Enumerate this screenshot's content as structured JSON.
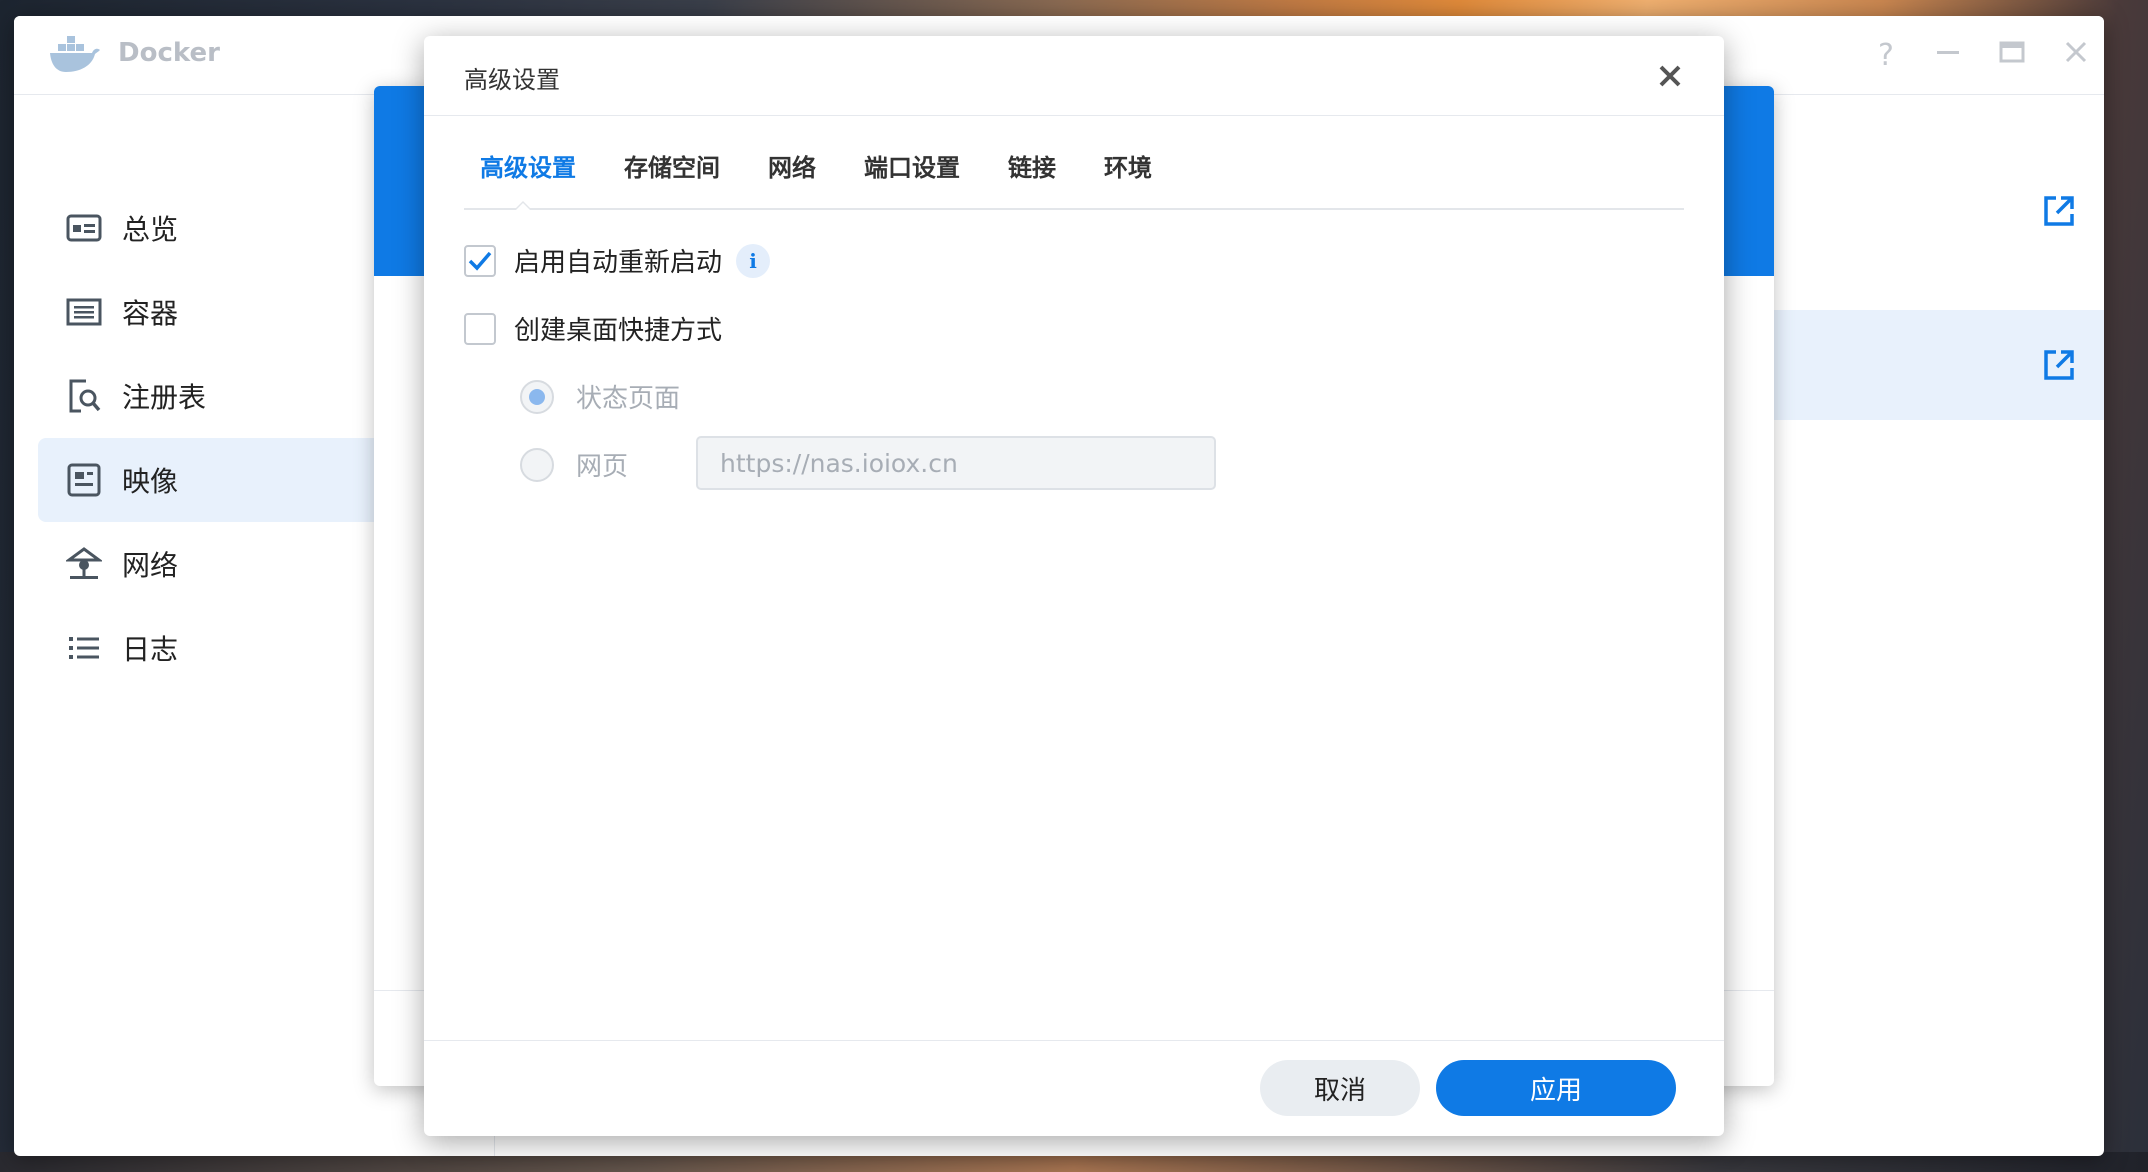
{
  "app": {
    "title": "Docker",
    "help": "?",
    "icon": "docker-whale-icon"
  },
  "sidebar": {
    "items": [
      {
        "label": "总览",
        "icon": "overview-icon"
      },
      {
        "label": "容器",
        "icon": "container-list-icon"
      },
      {
        "label": "注册表",
        "icon": "registry-search-icon"
      },
      {
        "label": "映像",
        "icon": "image-icon",
        "active": true
      },
      {
        "label": "网络",
        "icon": "network-icon"
      },
      {
        "label": "日志",
        "icon": "log-list-icon"
      }
    ]
  },
  "dialog": {
    "title": "高级设置",
    "tabs": [
      {
        "label": "高级设置",
        "active": true
      },
      {
        "label": "存储空间"
      },
      {
        "label": "网络"
      },
      {
        "label": "端口设置"
      },
      {
        "label": "链接"
      },
      {
        "label": "环境"
      }
    ],
    "auto_restart": {
      "label": "启用自动重新启动",
      "checked": true,
      "info": "i"
    },
    "shortcut": {
      "label": "创建桌面快捷方式",
      "checked": false
    },
    "status_page": {
      "label": "状态页面",
      "selected": true
    },
    "webpage": {
      "label": "网页",
      "url_value": "https://nas.ioiox.cn",
      "selected": false
    },
    "buttons": {
      "cancel": "取消",
      "apply": "应用"
    }
  },
  "colors": {
    "accent": "#0f7ae5",
    "active_nav_bg": "#e8f1fc"
  }
}
